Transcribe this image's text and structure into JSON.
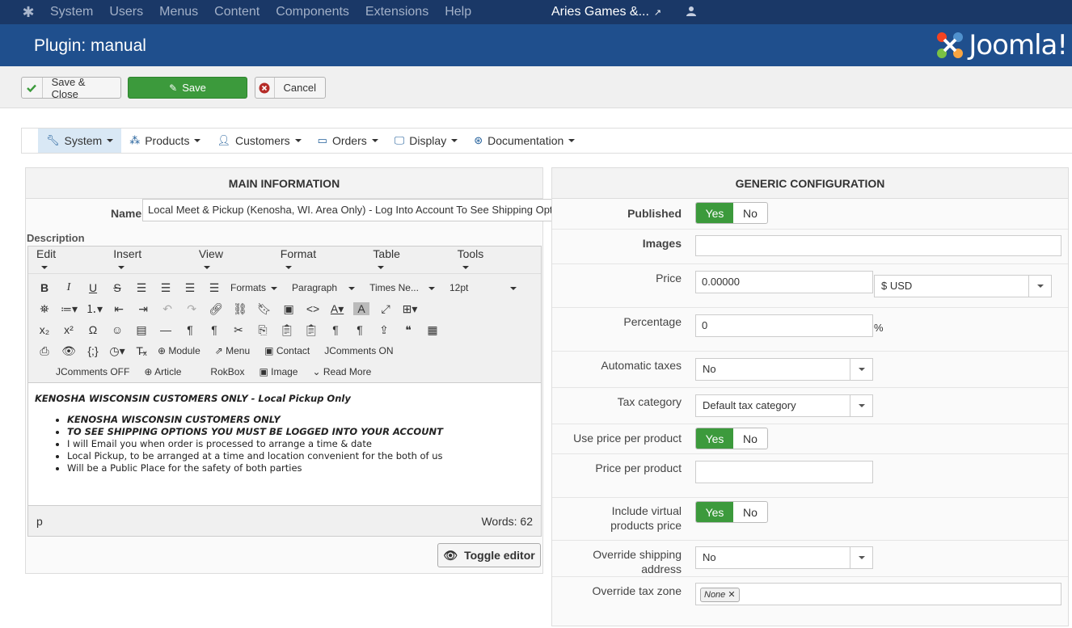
{
  "topbar": {
    "menu": [
      "System",
      "Users",
      "Menus",
      "Content",
      "Components",
      "Extensions",
      "Help"
    ],
    "site_name": "Aries Games &..."
  },
  "header": {
    "title": "Plugin: manual",
    "brand": "Joomla!"
  },
  "toolbar": {
    "save_close": "Save & Close",
    "save": "Save",
    "cancel": "Cancel"
  },
  "nav": [
    "System",
    "Products",
    "Customers",
    "Orders",
    "Display",
    "Documentation"
  ],
  "main_info": {
    "heading": "MAIN INFORMATION",
    "name_label": "Name",
    "name_value": "Local Meet & Pickup (Kenosha, WI. Area Only) - Log Into Account To See Shipping Options",
    "desc_label": "Description"
  },
  "editor": {
    "menus": [
      "Edit",
      "Insert",
      "View",
      "Format",
      "Table",
      "Tools"
    ],
    "formats": "Formats",
    "paragraph": "Paragraph",
    "font": "Times Ne...",
    "size": "12pt",
    "row4_btns": [
      "Module",
      "Menu",
      "Contact",
      "JComments ON"
    ],
    "row5_btns": [
      "JComments OFF",
      "Article",
      "RokBox",
      "Image",
      "Read More"
    ],
    "content": {
      "first_line": "KENOSHA WISCONSIN CUSTOMERS ONLY - Local Pickup Only",
      "bullets_bold": [
        "KENOSHA WISCONSIN CUSTOMERS ONLY",
        "TO SEE SHIPPING OPTIONS YOU MUST BE LOGGED INTO YOUR ACCOUNT"
      ],
      "bullets": [
        "I will Email you when order is processed to arrange a time & date",
        "Local Pickup, to be arranged at a time and location convenient for the both of us",
        "Will be a Public Place for the safety of both parties"
      ]
    },
    "status_path": "p",
    "words": "Words: 62",
    "toggle": "Toggle editor"
  },
  "generic": {
    "heading": "GENERIC CONFIGURATION",
    "yes": "Yes",
    "no": "No",
    "published": "Published",
    "images": "Images",
    "price": "Price",
    "price_value": "0.00000",
    "currency": "$ USD",
    "percentage": "Percentage",
    "percentage_value": "0",
    "percent_sign": "%",
    "auto_taxes": "Automatic taxes",
    "auto_taxes_value": "No",
    "tax_category": "Tax category",
    "tax_category_value": "Default tax category",
    "use_price_per_product": "Use price per product",
    "price_per_product": "Price per product",
    "include_virtual_1": "Include virtual",
    "include_virtual_2": "products price",
    "override_shipping": "Override shipping address",
    "override_shipping_value": "No",
    "override_tax_zone": "Override tax zone",
    "tax_zone_chip": "None"
  }
}
